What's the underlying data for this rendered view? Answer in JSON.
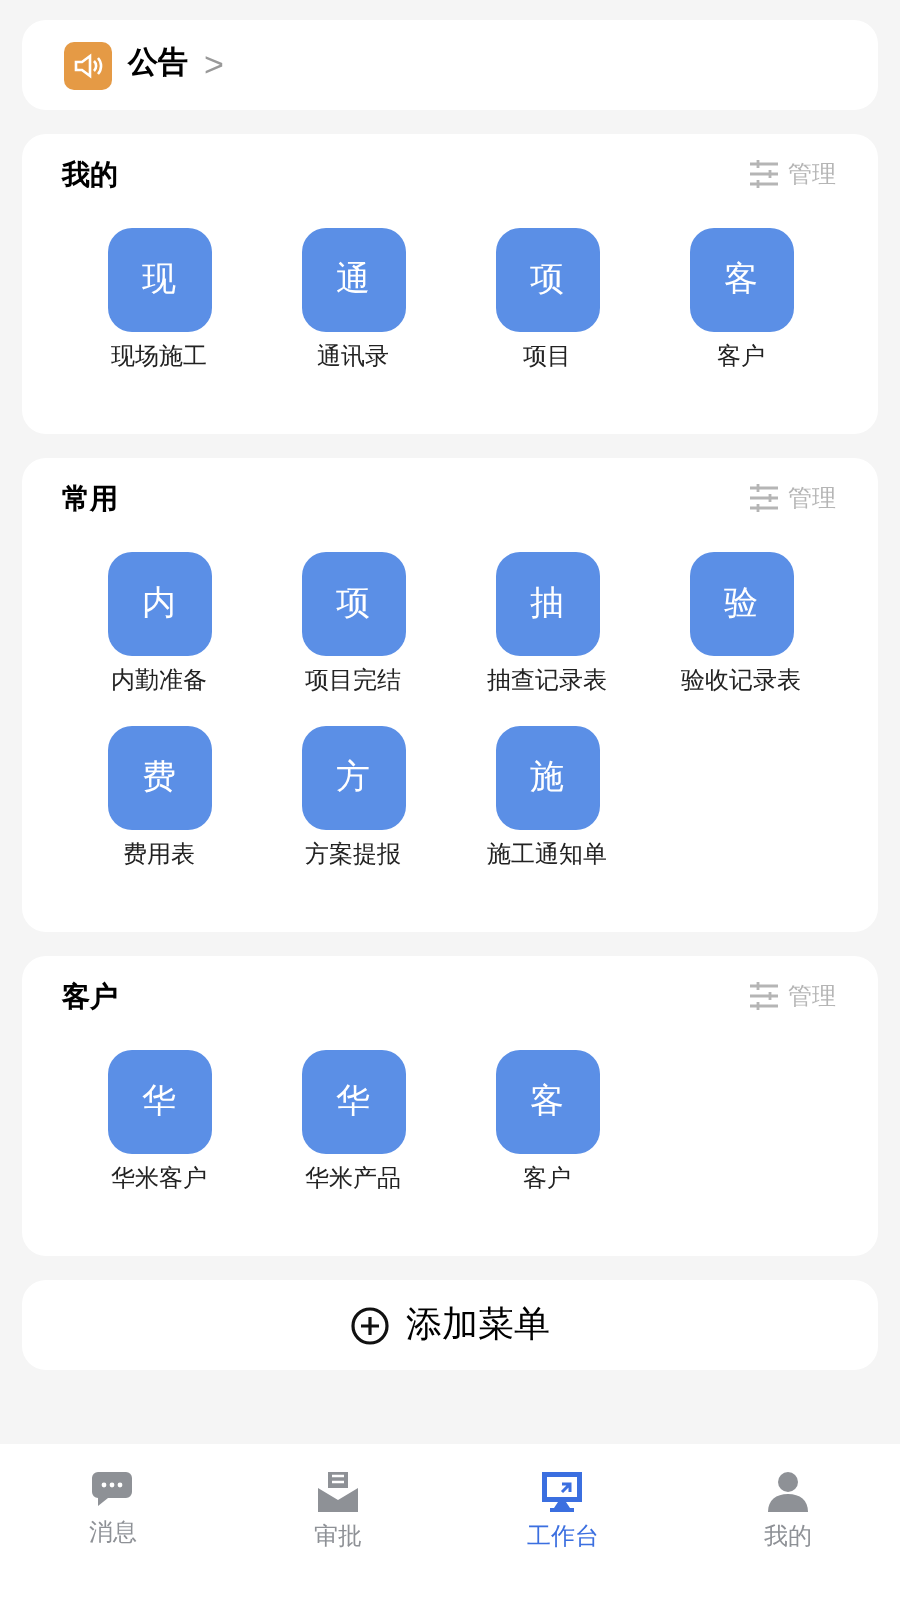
{
  "notice": {
    "title": "公告",
    "arrow": ">"
  },
  "sections": [
    {
      "title": "我的",
      "manage": "管理",
      "items": [
        {
          "glyph": "现",
          "label": "现场施工"
        },
        {
          "glyph": "通",
          "label": "通讯录"
        },
        {
          "glyph": "项",
          "label": "项目"
        },
        {
          "glyph": "客",
          "label": "客户"
        }
      ]
    },
    {
      "title": "常用",
      "manage": "管理",
      "items": [
        {
          "glyph": "内",
          "label": "内勤准备"
        },
        {
          "glyph": "项",
          "label": "项目完结"
        },
        {
          "glyph": "抽",
          "label": "抽查记录表"
        },
        {
          "glyph": "验",
          "label": "验收记录表"
        },
        {
          "glyph": "费",
          "label": "费用表"
        },
        {
          "glyph": "方",
          "label": "方案提报"
        },
        {
          "glyph": "施",
          "label": "施工通知单"
        }
      ]
    },
    {
      "title": "客户",
      "manage": "管理",
      "items": [
        {
          "glyph": "华",
          "label": "华米客户"
        },
        {
          "glyph": "华",
          "label": "华米产品"
        },
        {
          "glyph": "客",
          "label": "客户"
        }
      ]
    }
  ],
  "add_menu": {
    "label": "添加菜单"
  },
  "tab_bar": [
    {
      "kind": "chat",
      "label": "消息",
      "selected": false
    },
    {
      "kind": "approve",
      "label": "审批",
      "selected": false
    },
    {
      "kind": "desk",
      "label": "工作台",
      "selected": true
    },
    {
      "kind": "person",
      "label": "我的",
      "selected": false
    }
  ]
}
